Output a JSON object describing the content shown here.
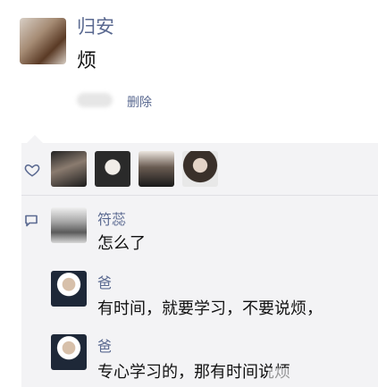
{
  "post": {
    "author": "归安",
    "text": "烦",
    "delete_label": "删除"
  },
  "likes": {
    "icon": "heart-icon",
    "count_avatars": 4
  },
  "comments": [
    {
      "name": "符蕊",
      "text": "怎么了"
    },
    {
      "name": "爸",
      "text": "有时间，就要学习，不要说烦，"
    },
    {
      "name": "爸",
      "text": "专心学习的，那有时间说烦"
    }
  ],
  "colors": {
    "name_link": "#5b6a91",
    "panel_bg": "#f3f3f5",
    "text": "#111111"
  }
}
